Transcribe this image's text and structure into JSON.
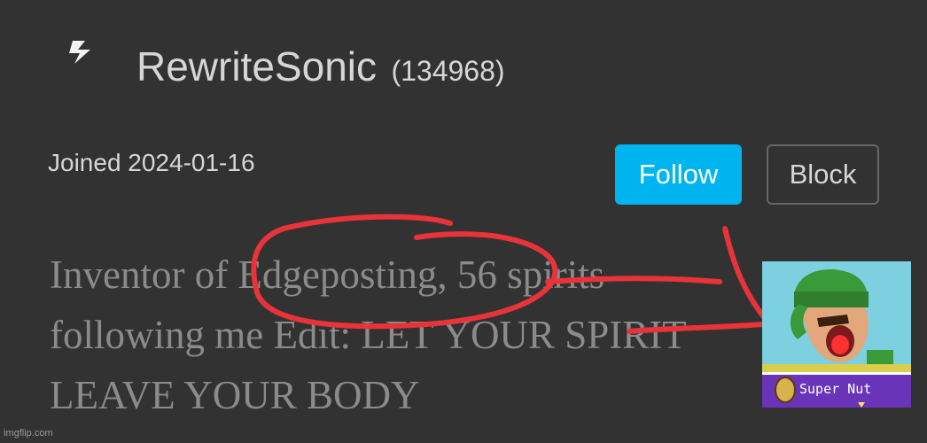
{
  "profile": {
    "username": "RewriteSonic",
    "user_id": "(134968)",
    "joined": "Joined 2024-01-16",
    "bio": "Inventor of Edgeposting, 56 spirits\nfollowing me Edit: LET YOUR SPIRIT\nLEAVE YOUR BODY"
  },
  "actions": {
    "follow_label": "Follow",
    "block_label": "Block"
  },
  "meme": {
    "label": "Super  Nut"
  },
  "watermark": "imgflip.com",
  "colors": {
    "background": "#323232",
    "follow_button": "#00b4ef",
    "annotation": "#e8333a",
    "text": "#d6d6d6",
    "bio_text": "#8b8b8b"
  },
  "icons": {
    "avatar": "lightning-bolt-icon"
  }
}
